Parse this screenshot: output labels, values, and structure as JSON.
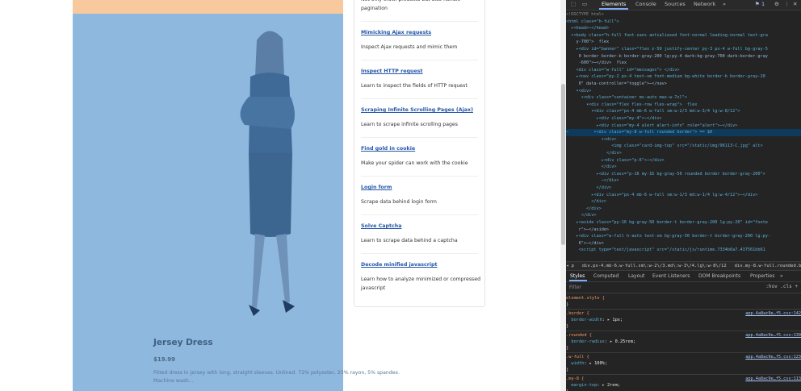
{
  "product": {
    "title": "Jersey Dress",
    "price": "$19.99",
    "description": "Fitted dress in jersey with long, straight sleeves. Unlined. 72% polyester, 23% rayon, 5% spandex. Machine wash..."
  },
  "sidebar": {
    "top_text": "Not only crawl products but also handle pagination",
    "items": [
      {
        "link": "Mimicking Ajax requests",
        "desc": "Inspect Ajax requests and mimic them"
      },
      {
        "link": "Inspect HTTP request",
        "desc": "Learn to inspect the fields of HTTP request"
      },
      {
        "link": "Scraping Infinite Scrolling Pages (Ajax)",
        "desc": "Learn to scrape infinite scrolling pages"
      },
      {
        "link": "Find gold in cookie",
        "desc": "Make your spider can work with the cookie"
      },
      {
        "link": "Login form",
        "desc": "Scrape data behind login form"
      },
      {
        "link": "Solve Captcha",
        "desc": "Learn to scrape data behind a captcha"
      },
      {
        "link": "Decode minified javascript",
        "desc": "Learn how to analyze minimized or compressed javascript"
      }
    ]
  },
  "devtools": {
    "tabs": [
      "Elements",
      "Console",
      "Sources",
      "Network",
      "»"
    ],
    "issues_badge": "1",
    "dom": [
      {
        "text": "<!DOCTYPE html>",
        "cls": "cm"
      },
      {
        "text": "<html class=\"h-full\">",
        "cls": "tg"
      },
      {
        "text": "  ▸<head>⋯</head>",
        "cls": "tg"
      },
      {
        "text": "  ▾<body class=\"h-full font-sans antialiased font-normal leading-normal text-gra",
        "cls": "tg"
      },
      {
        "text": "    y-700\">  flex",
        "cls": "at"
      },
      {
        "text": "    ▸<div id=\"banner\" class=\"flex z-50 justify-center py-3 px-4 w-full bg-gray-5",
        "cls": "tg"
      },
      {
        "text": "     0 border border-b border-gray-200 lg:py-4 dark:bg-gray-700 dark:border-gray",
        "cls": "at"
      },
      {
        "text": "     -600\">⋯</div>  flex",
        "cls": "at"
      },
      {
        "text": "    <div class=\"w-full\" id=\"messages\"> </div>",
        "cls": "tg"
      },
      {
        "text": "    ▸<nav class=\"py-2 px-4 text-sm font-medium bg-white border-b border-gray-20",
        "cls": "tg"
      },
      {
        "text": "     0\" data-controller=\"toggle\">⋯</nav>",
        "cls": "at"
      },
      {
        "text": "    ▾<div>",
        "cls": "tg"
      },
      {
        "text": "      ▾<div class=\"container mx-auto max-w-7xl\">",
        "cls": "tg"
      },
      {
        "text": "        ▾<div class=\"flex flex-row flex-wrap\">  flex",
        "cls": "tg"
      },
      {
        "text": "          ▾<div class=\"px-4 mb-6 w-full sm:w-2/3 md:w-3/4 lg:w-8/12\">",
        "cls": "tg"
      },
      {
        "text": "            ▸<div class=\"my-4\">⋯</div>",
        "cls": "tg"
      },
      {
        "text": "            ▸<div class=\"my-4 alert alert-info\" role=\"alert\">⋯</div>",
        "cls": "tg"
      },
      {
        "text": "⋯          ▾<div class=\"my-8 w-full rounded border\"> == $0",
        "cls": "tg",
        "sel": true
      },
      {
        "text": "              ▾<div>",
        "cls": "tg"
      },
      {
        "text": "                  <img class=\"card-img-top\" src=\"/static/img/96113-C.jpg\" alt>",
        "cls": "tg"
      },
      {
        "text": "                </div>",
        "cls": "tg"
      },
      {
        "text": "              ▸<div class=\"p-6\">⋯</div>",
        "cls": "tg"
      },
      {
        "text": "              </div>",
        "cls": "tg"
      },
      {
        "text": "            ▸<div class=\"p-16 my-16 bg-gray-50 rounded border border-gray-200\">",
        "cls": "tg"
      },
      {
        "text": "              ⋯</div>",
        "cls": "tg"
      },
      {
        "text": "            </div>",
        "cls": "tg"
      },
      {
        "text": "          ▸<div class=\"px-4 mb-6 w-full sm:w-1/3 md:w-1/4 lg:w-4/12\">⋯</div>",
        "cls": "tg"
      },
      {
        "text": "          </div>",
        "cls": "tg"
      },
      {
        "text": "        </div>",
        "cls": "tg"
      },
      {
        "text": "      </div>",
        "cls": "tg"
      },
      {
        "text": "    ▸<aside class=\"py-16 bg-gray-50 border-t border-gray-200 lg:py-20\" id=\"foote",
        "cls": "tg"
      },
      {
        "text": "     r\">⋯</aside>",
        "cls": "at"
      },
      {
        "text": "    ▸<div class=\"w-full h-auto text-sm bg-gray-50 border-t border-gray-200 lg:py-",
        "cls": "tg"
      },
      {
        "text": "     6\">⋯</div>",
        "cls": "at"
      },
      {
        "text": "     <script type=\"text/javascript\" src=\"/static/js/runtime.7334b6a7.437561bb61",
        "cls": "tg"
      }
    ],
    "breadcrumb": "◂ p   div.px-4.mb-6.w-full.sm\\:w-2\\/3.md\\:w-3\\/4.lg\\:w-8\\/12   div.my-8.w-full.rounded.border",
    "style_tabs": [
      "Styles",
      "Computed",
      "Layout",
      "Event Listeners",
      "DOM Breakpoints",
      "Properties",
      "»"
    ],
    "filter_placeholder": "Filter",
    "filter_tools": ":hov  .cls  +",
    "rules": [
      {
        "selector": "element.style {",
        "prop": "",
        "value": "",
        "src": ""
      },
      {
        "selector": ".border {",
        "prop": "border-width",
        "value": "1px",
        "src": "app.4a8ac9e…f5.css:142"
      },
      {
        "selector": ".rounded {",
        "prop": "border-radius",
        "value": "0.25rem",
        "src": "app.4a8ac9e…f5.css:139"
      },
      {
        "selector": ".w-full {",
        "prop": "width",
        "value": "100%",
        "src": "app.4a8ac9e…f5.css:123"
      },
      {
        "selector": ".my-8 {",
        "prop": "margin-top",
        "value": "2rem",
        "src": "app.4a8ac9e…f5.css:113"
      }
    ]
  }
}
